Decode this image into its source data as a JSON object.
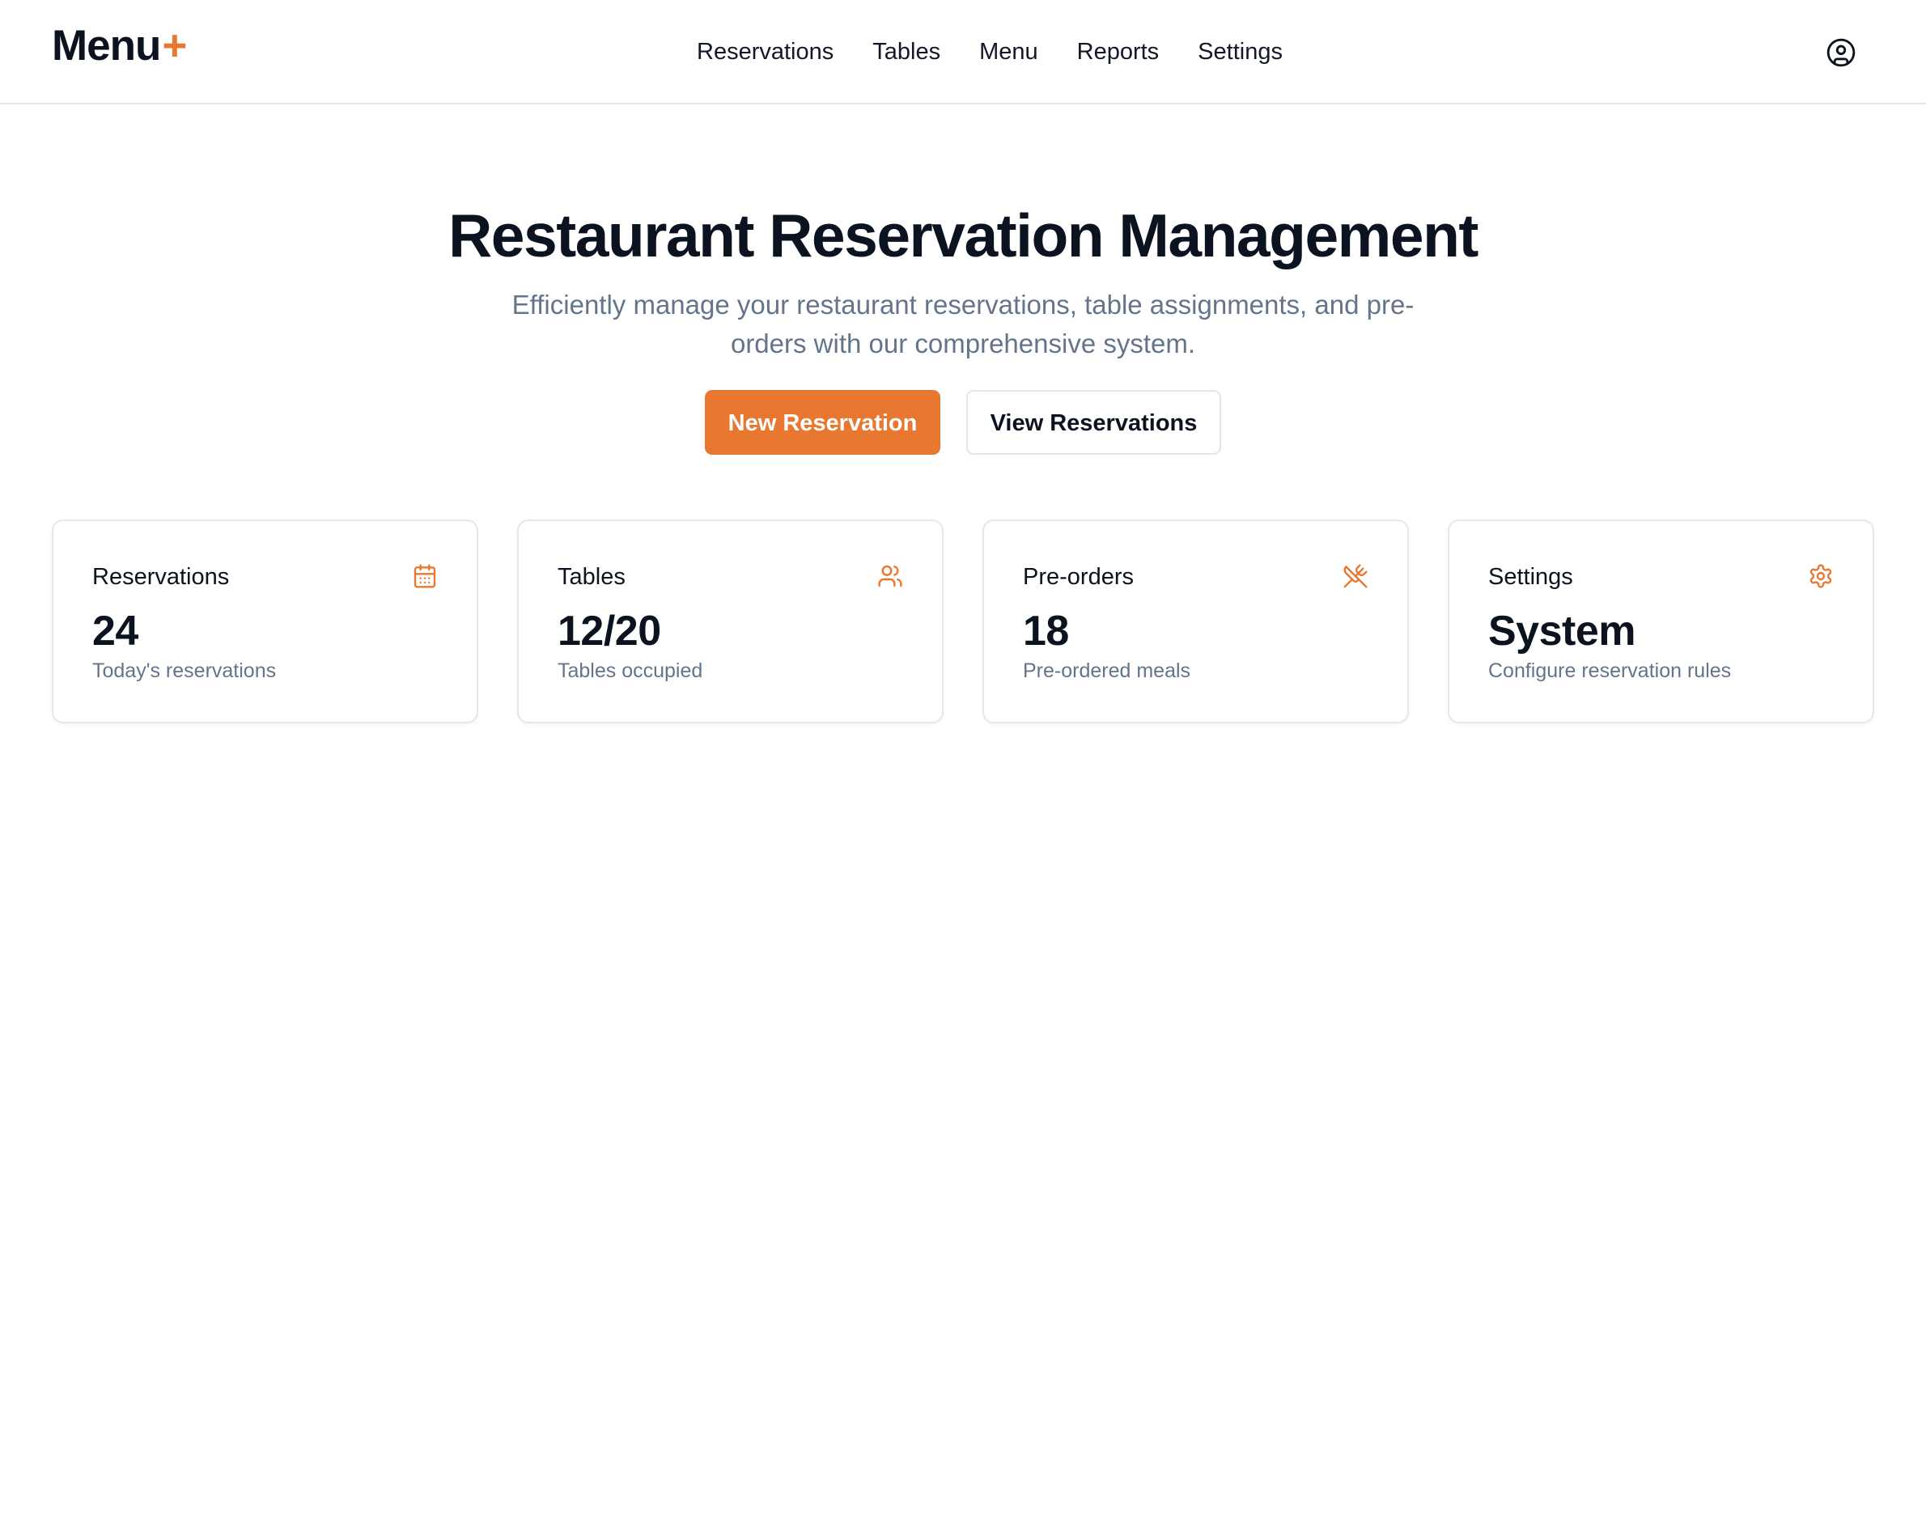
{
  "brand": {
    "name": "Menu",
    "mark": "+"
  },
  "nav": {
    "items": [
      {
        "label": "Reservations"
      },
      {
        "label": "Tables"
      },
      {
        "label": "Menu"
      },
      {
        "label": "Reports"
      },
      {
        "label": "Settings"
      }
    ],
    "profile_icon": "user-circle-icon"
  },
  "hero": {
    "title": "Restaurant Reservation Management",
    "subtitle": "Efficiently manage your restaurant reservations, table assignments, and pre-orders with our comprehensive system."
  },
  "actions": {
    "primary_label": "New Reservation",
    "secondary_label": "View Reservations"
  },
  "cards": [
    {
      "title": "Reservations",
      "value": "24",
      "description": "Today's reservations",
      "icon": "calendar-icon"
    },
    {
      "title": "Tables",
      "value": "12/20",
      "description": "Tables occupied",
      "icon": "users-icon"
    },
    {
      "title": "Pre-orders",
      "value": "18",
      "description": "Pre-ordered meals",
      "icon": "utensils-crossed-icon"
    },
    {
      "title": "Settings",
      "value": "System",
      "description": "Configure reservation rules",
      "icon": "gear-icon"
    }
  ],
  "colors": {
    "accent": "#e8772f",
    "text": "#0b1220",
    "muted": "#64748b",
    "border": "#e4e7ec"
  }
}
